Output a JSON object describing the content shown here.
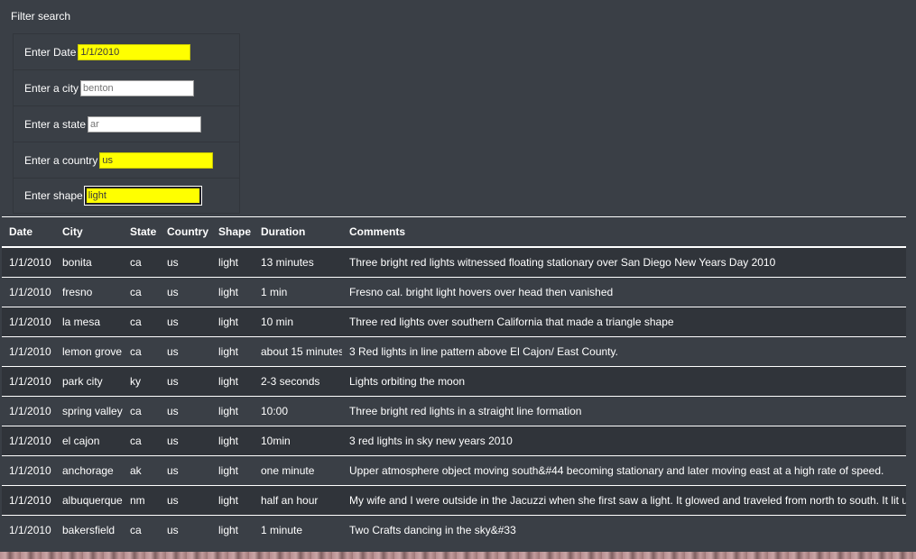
{
  "filter": {
    "title": "Filter search",
    "fields": [
      {
        "label": "Enter Date",
        "value": "1/1/2010",
        "placeholder": ""
      },
      {
        "label": "Enter a city",
        "value": "",
        "placeholder": "benton"
      },
      {
        "label": "Enter a state",
        "value": "",
        "placeholder": "ar"
      },
      {
        "label": "Enter a country",
        "value": "us",
        "placeholder": ""
      },
      {
        "label": "Enter shape",
        "value": "light",
        "placeholder": ""
      }
    ]
  },
  "table": {
    "headers": [
      "Date",
      "City",
      "State",
      "Country",
      "Shape",
      "Duration",
      "Comments"
    ],
    "rows": [
      [
        "1/1/2010",
        "bonita",
        "ca",
        "us",
        "light",
        "13 minutes",
        "Three bright red lights witnessed floating stationary over San Diego New Years Day 2010"
      ],
      [
        "1/1/2010",
        "fresno",
        "ca",
        "us",
        "light",
        "1 min",
        "Fresno cal. bright light hovers over head then vanished"
      ],
      [
        "1/1/2010",
        "la mesa",
        "ca",
        "us",
        "light",
        "10 min",
        "Three red lights over southern California that made a triangle shape"
      ],
      [
        "1/1/2010",
        "lemon grove",
        "ca",
        "us",
        "light",
        "about 15 minutes",
        "3 Red lights in line pattern above El Cajon/ East County."
      ],
      [
        "1/1/2010",
        "park city",
        "ky",
        "us",
        "light",
        "2-3 seconds",
        "Lights orbiting the moon"
      ],
      [
        "1/1/2010",
        "spring valley",
        "ca",
        "us",
        "light",
        "10:00",
        "Three bright red lights in a straight line formation"
      ],
      [
        "1/1/2010",
        "el cajon",
        "ca",
        "us",
        "light",
        "10min",
        "3 red lights in sky new years 2010"
      ],
      [
        "1/1/2010",
        "anchorage",
        "ak",
        "us",
        "light",
        "one minute",
        "Upper atmosphere object moving south&#44 becoming stationary and later moving east at a high rate of speed."
      ],
      [
        "1/1/2010",
        "albuquerque",
        "nm",
        "us",
        "light",
        "half an hour",
        "My wife and I were outside in the Jacuzzi when she first saw a light. It glowed and traveled from north to south. It lit up again whe"
      ],
      [
        "1/1/2010",
        "bakersfield",
        "ca",
        "us",
        "light",
        "1 minute",
        "Two Crafts dancing in the sky&#33"
      ]
    ]
  },
  "colors": {
    "background": "#3a3f46",
    "highlight": "#ffff00",
    "text": "#ffffff"
  }
}
